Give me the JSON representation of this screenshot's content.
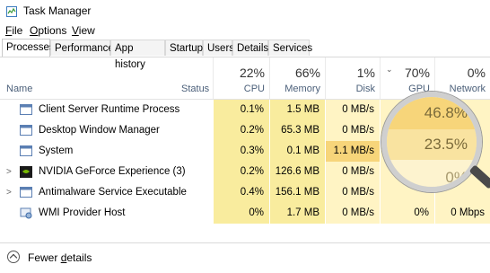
{
  "window": {
    "title": "Task Manager"
  },
  "menu": [
    {
      "pre": "",
      "u": "F",
      "post": "ile"
    },
    {
      "pre": "",
      "u": "O",
      "post": "ptions"
    },
    {
      "pre": "",
      "u": "V",
      "post": "iew"
    }
  ],
  "tabs": [
    "Processes",
    "Performance",
    "App history",
    "Startup",
    "Users",
    "Details",
    "Services"
  ],
  "active_tab": "Processes",
  "columns": {
    "name": "Name",
    "status": "Status",
    "cpu": {
      "pct": "22%",
      "label": "CPU"
    },
    "memory": {
      "pct": "66%",
      "label": "Memory"
    },
    "disk": {
      "pct": "1%",
      "label": "Disk"
    },
    "gpu": {
      "pct": "70%",
      "label": "GPU"
    },
    "network": {
      "pct": "0%",
      "label": "Network"
    }
  },
  "colors": {
    "heat_light": "#fff4c4",
    "heat_mid": "#f9ec9e",
    "heat_strong": "#f7d57a",
    "heat_gpu": "#f5c85e"
  },
  "processes": [
    {
      "name": "Client Server Runtime Process",
      "expandable": false,
      "icon": "system-window-icon",
      "cpu": "0.1%",
      "memory": "1.5 MB",
      "disk": "0 MB/s",
      "gpu": "",
      "network": ""
    },
    {
      "name": "Desktop Window Manager",
      "expandable": false,
      "icon": "system-window-icon",
      "cpu": "0.2%",
      "memory": "65.3 MB",
      "disk": "0 MB/s",
      "gpu": "",
      "network": ""
    },
    {
      "name": "System",
      "expandable": false,
      "icon": "system-window-icon",
      "cpu": "0.3%",
      "memory": "0.1 MB",
      "disk": "1.1 MB/s",
      "gpu": "",
      "network": ""
    },
    {
      "name": "NVIDIA GeForce Experience (3)",
      "expandable": true,
      "icon": "nvidia-icon",
      "cpu": "0.2%",
      "memory": "126.6 MB",
      "disk": "0 MB/s",
      "gpu": "",
      "network": ""
    },
    {
      "name": "Antimalware Service Executable",
      "expandable": true,
      "icon": "system-window-icon",
      "cpu": "0.4%",
      "memory": "156.1 MB",
      "disk": "0 MB/s",
      "gpu": "",
      "network": ""
    },
    {
      "name": "WMI Provider Host",
      "expandable": false,
      "icon": "wmi-icon",
      "cpu": "0%",
      "memory": "1.7 MB",
      "disk": "0 MB/s",
      "gpu": "0%",
      "network": "0 Mbps"
    }
  ],
  "magnifier": {
    "values": [
      "46.8%",
      "23.5%",
      "0%"
    ]
  },
  "footer": {
    "pre": "Fewer ",
    "u": "d",
    "post": "etails"
  }
}
